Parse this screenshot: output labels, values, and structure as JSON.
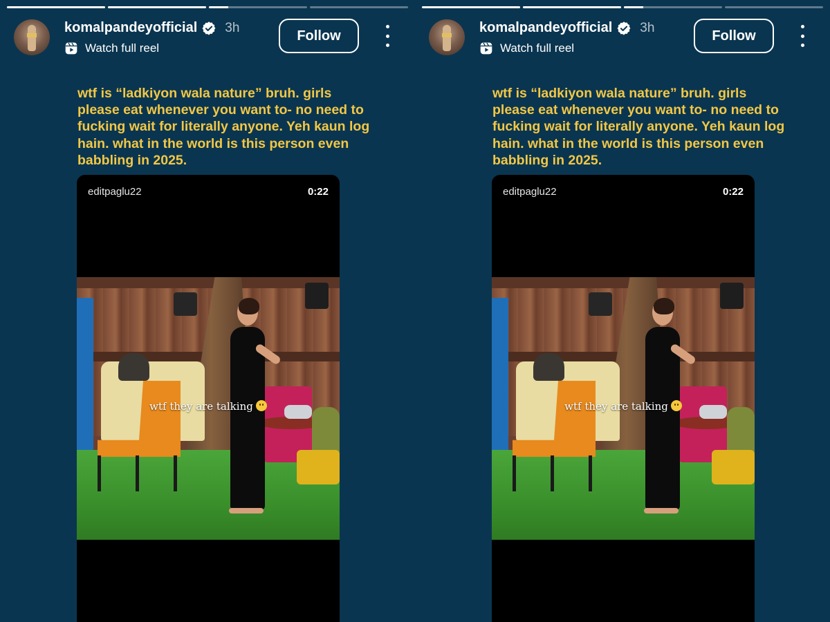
{
  "story": {
    "username": "komalpandeyofficial",
    "time_ago": "3h",
    "reel_link_label": "Watch full reel",
    "follow_label": "Follow",
    "caption": "wtf is “ladkiyon wala nature” bruh. girls please eat whenever you want to- no need to fucking wait for literally anyone. Yeh kaun log hain. what in the world is this person even babbling in 2025.",
    "progress": {
      "segments_total": 4,
      "segments_complete": 2,
      "current_segment_fraction": 0.2
    },
    "shared_reel": {
      "source_username": "editpaglu22",
      "duration": "0:22",
      "overlay_text": "wtf they are talking"
    },
    "icons": {
      "verified": "verified-badge-icon",
      "reel": "reel-icon",
      "more": "more-vertical-icon",
      "emoji": "slightly-smiling-face-emoji"
    },
    "colors": {
      "background": "#0a3550",
      "caption": "#f2c745",
      "verified_badge": "#ffffff"
    }
  }
}
